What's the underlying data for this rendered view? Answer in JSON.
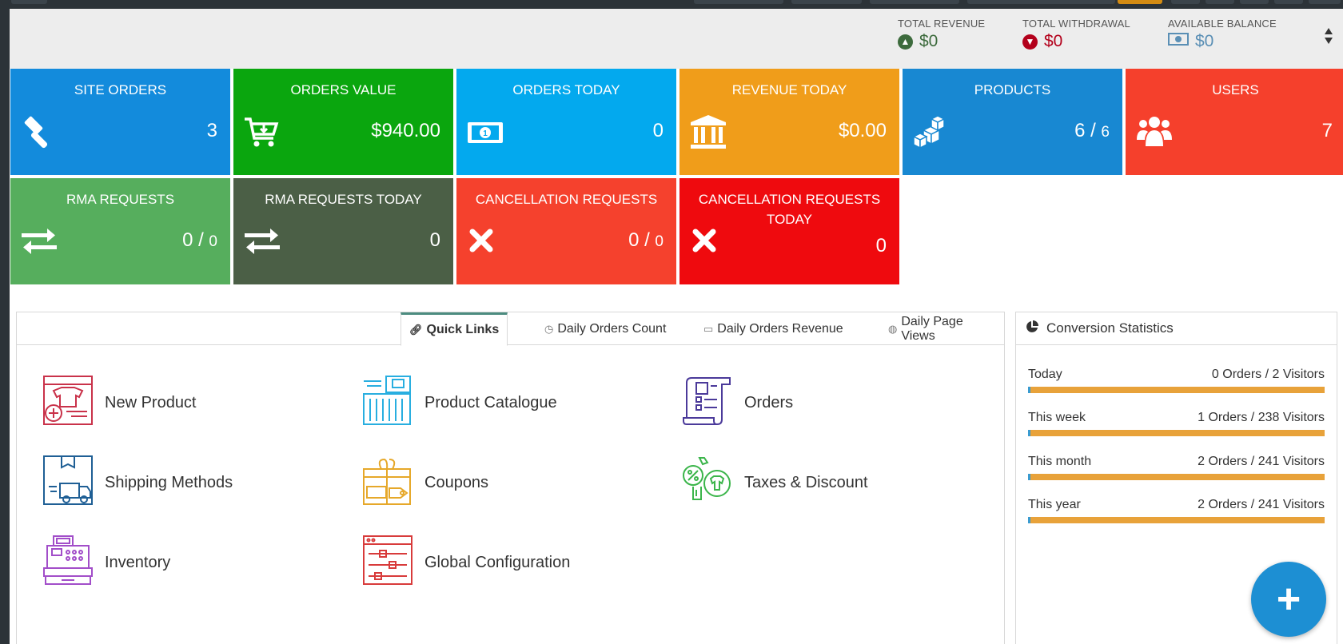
{
  "stats": {
    "total_revenue": {
      "label": "TOTAL REVENUE",
      "value": "$0",
      "color": "#3d6b3d"
    },
    "total_withdrawal": {
      "label": "TOTAL WITHDRAWAL",
      "value": "$0",
      "color": "#b3001b"
    },
    "available_balance": {
      "label": "AVAILABLE BALANCE",
      "value": "$0",
      "color": "#5a8fb5"
    }
  },
  "tiles": [
    {
      "title": "SITE ORDERS",
      "value": "3",
      "icon": "gavel-icon",
      "color": "#138bdc"
    },
    {
      "title": "ORDERS VALUE",
      "value": "$940.00",
      "icon": "cart-icon",
      "color": "#0aa60e"
    },
    {
      "title": "ORDERS TODAY",
      "value": "0",
      "icon": "money-icon",
      "color": "#03a9ee"
    },
    {
      "title": "REVENUE TODAY",
      "value": "$0.00",
      "icon": "bank-icon",
      "color": "#f09d1a"
    },
    {
      "title": "PRODUCTS",
      "value": "6 /",
      "value_small": "6",
      "icon": "cubes-icon",
      "color": "#1888d2"
    },
    {
      "title": "USERS",
      "value": "7",
      "icon": "users-icon",
      "color": "#f5402c"
    },
    {
      "title": "RMA REQUESTS",
      "value": "0 /",
      "value_small": "0",
      "icon": "exchange-icon",
      "color": "#56ae5d"
    },
    {
      "title": "RMA REQUESTS TODAY",
      "value": "0",
      "icon": "exchange-icon",
      "color": "#4b5f46"
    },
    {
      "title": "CANCELLATION REQUESTS",
      "value": "0 /",
      "value_small": "0",
      "icon": "close-icon",
      "color": "#f5412d"
    },
    {
      "title_line1": "CANCELLATION REQUESTS",
      "title_line2": "TODAY",
      "value": "0",
      "icon": "close-icon",
      "color": "#ef0a0e"
    }
  ],
  "tabs": [
    {
      "label": "Quick Links",
      "icon": "link-icon"
    },
    {
      "label": "Daily Orders Count",
      "icon": "clock-icon"
    },
    {
      "label": "Daily Orders Revenue",
      "icon": "money-icon"
    },
    {
      "label": "Daily Page Views",
      "icon": "globe-icon"
    }
  ],
  "quick_links": [
    {
      "label": "New Product",
      "icon": "new-product-icon",
      "color": "#c9324a"
    },
    {
      "label": "Product Catalogue",
      "icon": "catalogue-icon",
      "color": "#28aee0"
    },
    {
      "label": "Orders",
      "icon": "orders-icon",
      "color": "#4b3a9a"
    },
    {
      "label": "Shipping Methods",
      "icon": "shipping-icon",
      "color": "#1f5f95"
    },
    {
      "label": "Coupons",
      "icon": "coupons-icon",
      "color": "#e6a82a"
    },
    {
      "label": "Taxes & Discount",
      "icon": "taxes-icon",
      "color": "#3bb54a"
    },
    {
      "label": "Inventory",
      "icon": "inventory-icon",
      "color": "#a24ec9"
    },
    {
      "label": "Global Configuration",
      "icon": "config-icon",
      "color": "#d83b3b"
    }
  ],
  "conversion": {
    "title": "Conversion Statistics",
    "rows": [
      {
        "label": "Today",
        "value": "0 Orders / 2 Visitors"
      },
      {
        "label": "This week",
        "value": "1 Orders / 238 Visitors"
      },
      {
        "label": "This month",
        "value": "2 Orders / 241 Visitors"
      },
      {
        "label": "This year",
        "value": "2 Orders / 241 Visitors"
      }
    ]
  },
  "fab": {
    "label": "+"
  }
}
